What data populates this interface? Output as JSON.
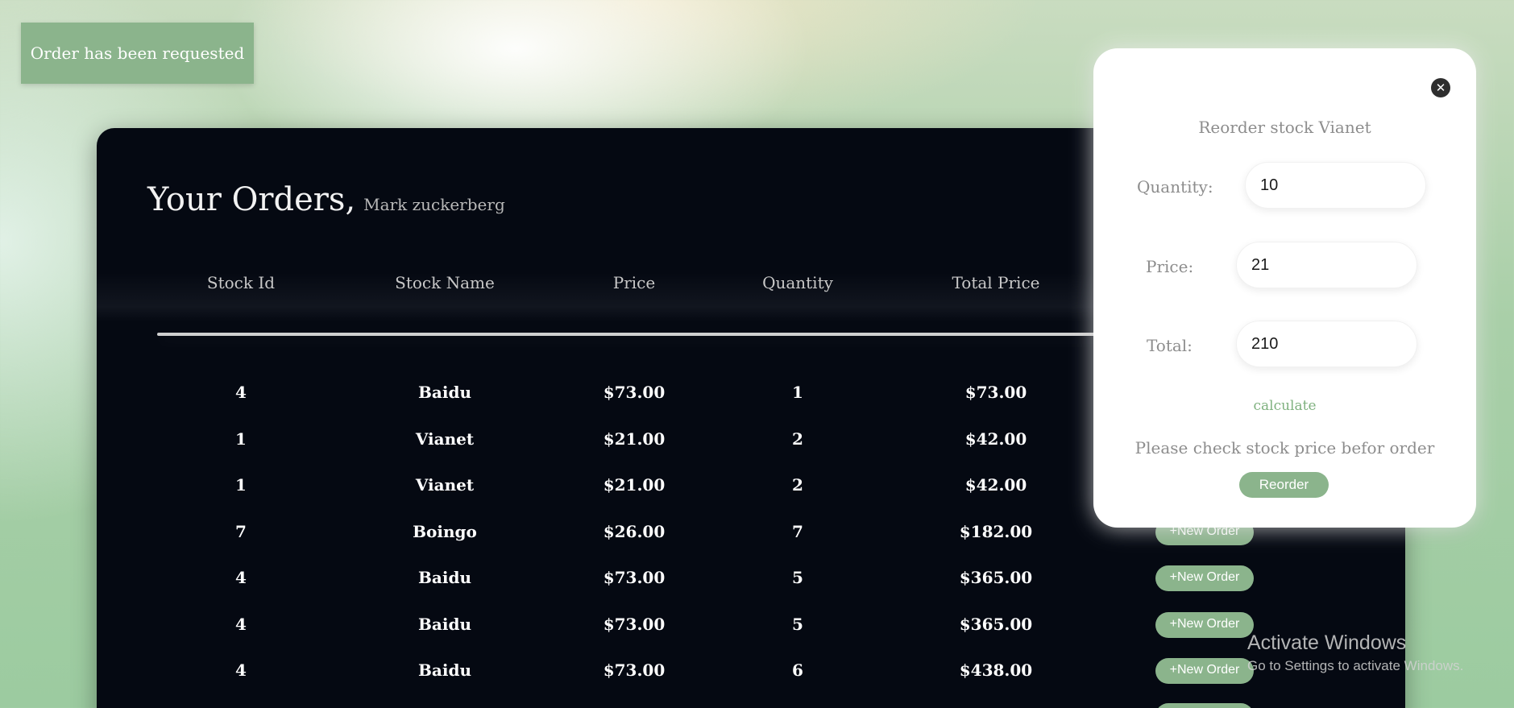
{
  "toast": {
    "message": "Order has been requested"
  },
  "orders": {
    "title": "Your Orders,",
    "user_name": "Mark zuckerberg",
    "columns": [
      "Stock Id",
      "Stock Name",
      "Price",
      "Quantity",
      "Total Price"
    ],
    "rows": [
      {
        "stock_id": "4",
        "stock_name": "Baidu",
        "price": "$73.00",
        "quantity": "1",
        "total_price": "$73.00"
      },
      {
        "stock_id": "1",
        "stock_name": "Vianet",
        "price": "$21.00",
        "quantity": "2",
        "total_price": "$42.00"
      },
      {
        "stock_id": "1",
        "stock_name": "Vianet",
        "price": "$21.00",
        "quantity": "2",
        "total_price": "$42.00"
      },
      {
        "stock_id": "7",
        "stock_name": "Boingo",
        "price": "$26.00",
        "quantity": "7",
        "total_price": "$182.00"
      },
      {
        "stock_id": "4",
        "stock_name": "Baidu",
        "price": "$73.00",
        "quantity": "5",
        "total_price": "$365.00"
      },
      {
        "stock_id": "4",
        "stock_name": "Baidu",
        "price": "$73.00",
        "quantity": "5",
        "total_price": "$365.00"
      },
      {
        "stock_id": "4",
        "stock_name": "Baidu",
        "price": "$73.00",
        "quantity": "6",
        "total_price": "$438.00"
      }
    ],
    "new_order_label": "+New Order"
  },
  "modal": {
    "title": "Reorder stock Vianet",
    "quantity_label": "Quantity:",
    "quantity_value": "10",
    "price_label": "Price:",
    "price_value": "21",
    "total_label": "Total:",
    "total_value": "210",
    "calculate_label": "calculate",
    "note": "Please check stock price befor order",
    "reorder_label": "Reorder",
    "close_icon": "close-icon"
  },
  "watermark": {
    "line1": "Activate Windows",
    "line2": "Go to Settings to activate Windows."
  },
  "colors": {
    "accent": "#8bb48c",
    "panel_bg": "#050912",
    "link": "#7fb17f"
  }
}
